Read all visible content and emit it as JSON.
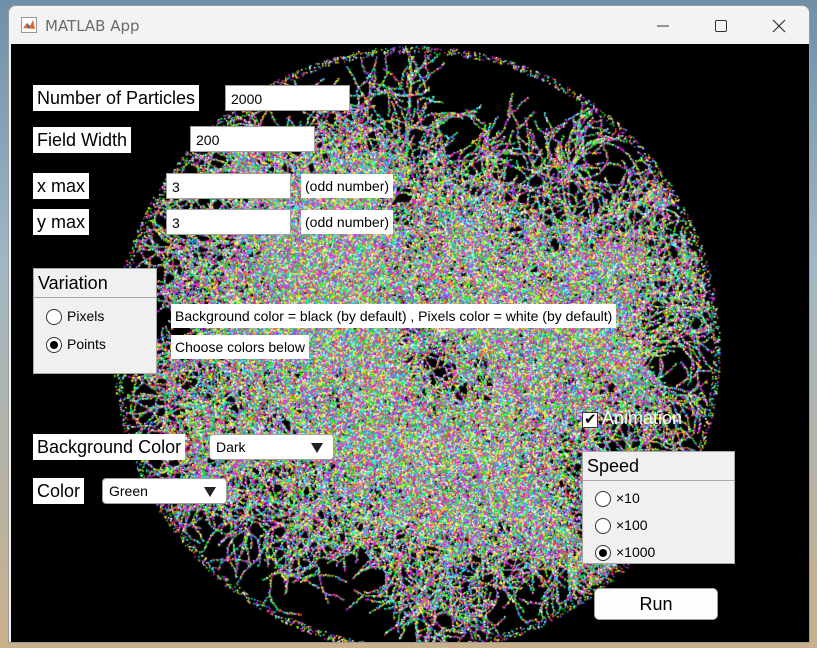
{
  "window": {
    "title": "MATLAB App"
  },
  "icons": {
    "app": "matlab-logo-icon",
    "minimize": "minimize-icon",
    "maximize": "maximize-icon",
    "close": "close-icon"
  },
  "form": {
    "particles_label": "Number of Particles",
    "particles_value": "2000",
    "field_width_label": "Field Width",
    "field_width_value": "200",
    "xmax_label": "x max",
    "xmax_value": "3",
    "xmax_note": "(odd number)",
    "ymax_label": "y max",
    "ymax_value": "3",
    "ymax_note": "(odd number)"
  },
  "variation": {
    "title": "Variation",
    "options": [
      "Pixels",
      "Points"
    ],
    "selected": "Points"
  },
  "info": {
    "default_note": "Background color = black (by default) , Pixels color = white (by default)",
    "choose_note": "Choose colors below"
  },
  "background_color": {
    "label": "Background Color",
    "value": "Dark"
  },
  "color": {
    "label": "Color",
    "value": "Green"
  },
  "animation": {
    "label": "Animation",
    "checked": true
  },
  "speed": {
    "title": "Speed",
    "options": [
      "×10",
      "×100",
      "×1000"
    ],
    "selected": "×1000"
  },
  "run_label": "Run",
  "colors": {
    "canvas_background": "#000000",
    "panel_background": "#f0f0f0",
    "particle_palette": [
      "#ffffff",
      "#00ff00",
      "#ff00ff",
      "#00ffff",
      "#ffff00",
      "#ff4040",
      "#6060ff"
    ]
  }
}
